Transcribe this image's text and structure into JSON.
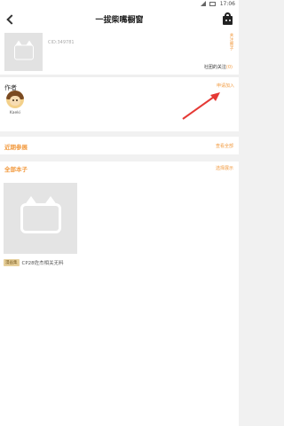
{
  "status_bar": {
    "time": "17:06"
  },
  "header": {
    "title": "一拔柴嘴橱窗"
  },
  "profile": {
    "cid": "CID:349781",
    "follow_label": "关注圈子",
    "fan_text_prefix": "社团的关注",
    "fan_count": "(0)"
  },
  "authors": {
    "title": "作者",
    "apply_label": "申请加入",
    "items": [
      {
        "name": "Kaeki"
      }
    ]
  },
  "recent": {
    "title": "近期参展",
    "link": "查看全部"
  },
  "books": {
    "title": "全部本子",
    "link": "选择展示",
    "items": [
      {
        "badge": "漫画集",
        "title": "CP28佐杰相关无料"
      }
    ]
  },
  "colors": {
    "accent": "#f29a3f",
    "annotation_arrow": "#e53935"
  }
}
